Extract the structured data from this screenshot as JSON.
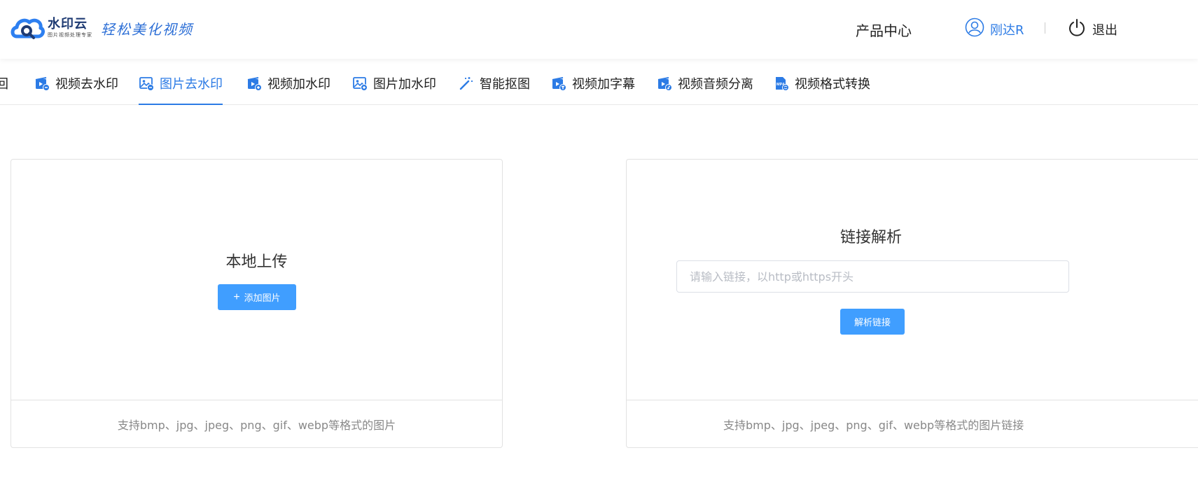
{
  "header": {
    "logo_name": "水印云",
    "logo_sub": "图片视频处理专家",
    "slogan": "轻松美化视频",
    "product_center": "产品中心",
    "username": "刚达R",
    "logout": "退出"
  },
  "tabs": [
    {
      "label": "返回",
      "icon": "back-icon"
    },
    {
      "label": "视频去水印",
      "icon": "video-remove-icon"
    },
    {
      "label": "图片去水印",
      "icon": "image-remove-icon",
      "active": true
    },
    {
      "label": "视频加水印",
      "icon": "video-add-icon"
    },
    {
      "label": "图片加水印",
      "icon": "image-add-icon"
    },
    {
      "label": "智能抠图",
      "icon": "magic-wand-icon"
    },
    {
      "label": "视频加字幕",
      "icon": "video-subtitle-icon"
    },
    {
      "label": "视频音频分离",
      "icon": "video-audio-icon"
    },
    {
      "label": "视频格式转换",
      "icon": "mp4-format-icon"
    }
  ],
  "upload_panel": {
    "title": "本地上传",
    "button_label": "添加图片",
    "footer": "支持bmp、jpg、jpeg、png、gif、webp等格式的图片"
  },
  "link_panel": {
    "title": "链接解析",
    "input_placeholder": "请输入链接，以http或https开头",
    "input_value": "",
    "button_label": "解析链接",
    "footer": "支持bmp、jpg、jpeg、png、gif、webp等格式的图片链接"
  },
  "colors": {
    "accent": "#2c7be5",
    "button": "#409eff",
    "border": "#e2e2e2",
    "muted_text": "#888888"
  }
}
